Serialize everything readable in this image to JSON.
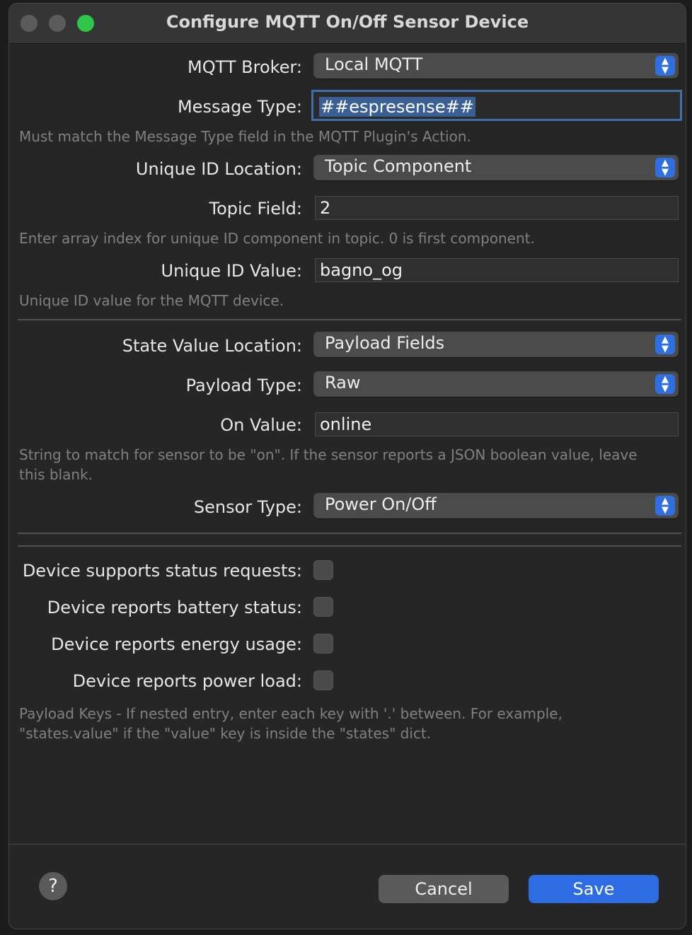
{
  "window": {
    "title": "Configure MQTT On/Off Sensor Device"
  },
  "form": {
    "mqtt_broker": {
      "label": "MQTT Broker:",
      "value": "Local MQTT"
    },
    "message_type": {
      "label": "Message Type:",
      "value": "##espresense##"
    },
    "message_type_hint": "Must match the Message Type field in the MQTT Plugin's Action.",
    "unique_id_location": {
      "label": "Unique ID Location:",
      "value": "Topic Component"
    },
    "topic_field": {
      "label": "Topic Field:",
      "value": "2"
    },
    "topic_field_hint": "Enter array index for unique ID component in topic.  0 is first component.",
    "unique_id_value": {
      "label": "Unique ID Value:",
      "value": "bagno_og"
    },
    "unique_id_value_hint": "Unique ID value for the MQTT device.",
    "state_value_location": {
      "label": "State Value Location:",
      "value": "Payload Fields"
    },
    "payload_type": {
      "label": "Payload Type:",
      "value": "Raw"
    },
    "on_value": {
      "label": "On Value:",
      "value": "online"
    },
    "on_value_hint_1": "String to match for sensor to be \"on\".  If the sensor reports a JSON boolean value, leave",
    "on_value_hint_2": "this blank.",
    "sensor_type": {
      "label": "Sensor Type:",
      "value": "Power On/Off"
    },
    "checks": [
      {
        "label": "Device supports status requests:",
        "checked": false
      },
      {
        "label": "Device reports battery status:",
        "checked": false
      },
      {
        "label": "Device reports energy usage:",
        "checked": false
      },
      {
        "label": "Device reports power load:",
        "checked": false
      }
    ],
    "payload_keys_hint_1": "Payload Keys - If nested entry, enter each key with '.' between.  For example,",
    "payload_keys_hint_2": "\"states.value\" if the \"value\" key is inside the \"states\" dict."
  },
  "footer": {
    "help_label": "?",
    "cancel_label": "Cancel",
    "save_label": "Save"
  },
  "colors": {
    "accent": "#2d6ce2",
    "window_bg": "#262626",
    "close_dot": "#5c5c5c",
    "zoom_dot": "#2fc64a"
  }
}
